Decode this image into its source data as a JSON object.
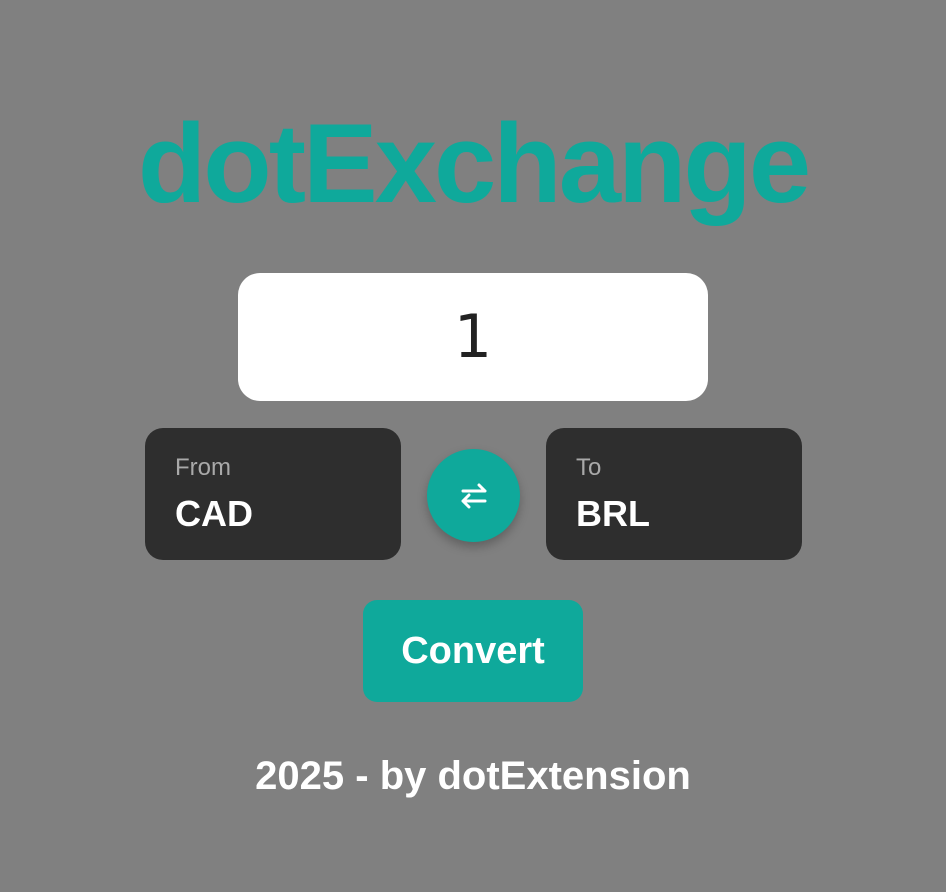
{
  "app": {
    "title": "dotExchange",
    "accent_color": "#0fa99b",
    "background_color": "#808080"
  },
  "amount": {
    "value": "1"
  },
  "from": {
    "label": "From",
    "currency": "CAD"
  },
  "swap": {
    "icon": "swap-horizontal-icon"
  },
  "to": {
    "label": "To",
    "currency": "BRL"
  },
  "actions": {
    "convert_label": "Convert"
  },
  "footer": {
    "text": "2025 - by dotExtension"
  }
}
